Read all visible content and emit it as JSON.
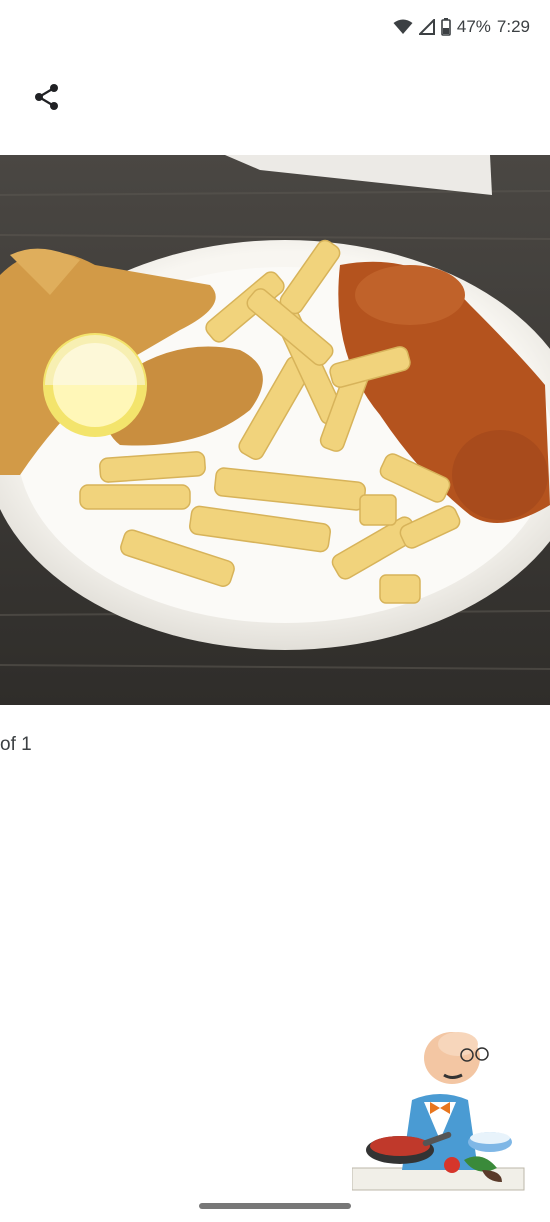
{
  "status_bar": {
    "battery_percent": "47%",
    "time": "7:29",
    "icons": [
      "wifi-icon",
      "signal-icon",
      "battery-icon"
    ]
  },
  "toolbar": {
    "share_icon": "share-icon"
  },
  "photo": {
    "counter_text": "of 1"
  },
  "colors": {
    "background": "#ffffff",
    "table": "#3d3b38",
    "plate": "#f7f5f0",
    "fries": "#f0d27a",
    "fish": "#d39a45",
    "wings": "#b5531d",
    "lemon": "#f5e469"
  }
}
